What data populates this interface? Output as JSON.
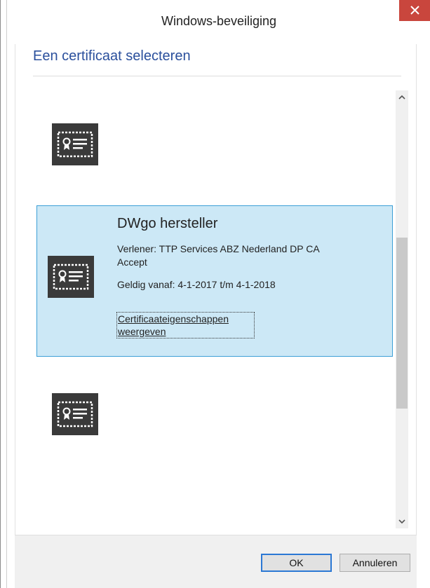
{
  "window": {
    "title": "Windows-beveiliging"
  },
  "dialog": {
    "heading": "Een certificaat selecteren"
  },
  "certificates": [
    {
      "name": "",
      "issuer": "",
      "validity": "",
      "link": ""
    },
    {
      "name": "DWgo hersteller",
      "issuer": "Verlener: TTP Services ABZ Nederland DP CA Accept",
      "validity": "Geldig vanaf: 4-1-2017 t/m 4-1-2018",
      "link": "Certificaateigenschappen weergeven",
      "selected": true
    },
    {
      "name": "",
      "issuer": "",
      "validity": "",
      "link": ""
    },
    {
      "name": "",
      "issuer": "",
      "validity": "",
      "link": ""
    }
  ],
  "buttons": {
    "ok_label": "OK",
    "cancel_label": "Annuleren"
  },
  "icons": {
    "certificate": "certificate-icon",
    "close": "close-icon",
    "scroll_up": "chevron-up-icon",
    "scroll_down": "chevron-down-icon"
  },
  "colors": {
    "heading": "#2a4f9c",
    "selection_bg": "#cce8f6",
    "selection_border": "#3c9fd6",
    "close_bg": "#c9463d",
    "icon_bg": "#3a3a3a"
  }
}
